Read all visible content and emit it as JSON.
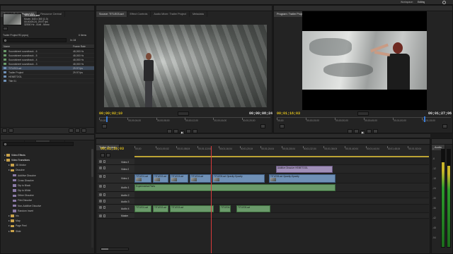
{
  "menu": {
    "items": [
      "File",
      "Edit",
      "Project",
      "Clip",
      "Sequence",
      "Marker",
      "Title",
      "Window",
      "Help"
    ],
    "workspace_label": "Workspace:",
    "workspace_value": "Editing"
  },
  "project": {
    "tabs": [
      "Project: Trailer Project R2",
      "Resource Central"
    ],
    "clip_name": "TITLE03.avi",
    "clip_info": [
      "Movie, 640 x 360 (1.0)",
      "00;00;09;24, 29.97 fps",
      "32000 Hz - 8-bit - Mono",
      "Trailer Project R2.prproj"
    ],
    "item_count": "6 Items",
    "search_placeholder": "In: All",
    "col_name": "Name",
    "col_rate": "Frame Rate",
    "items": [
      {
        "name": "Soundsheet soundtrack - 6",
        "rate": "48,000 Hz"
      },
      {
        "name": "Soundsheet soundtrack - 5",
        "rate": "48,000 Hz"
      },
      {
        "name": "Soundsheet soundtrack - 4",
        "rate": "48,000 Hz"
      },
      {
        "name": "Soundsheet soundtrack - 3",
        "rate": "48,000 Hz"
      },
      {
        "name": "TITLE03.avi",
        "rate": "29.97 fps"
      },
      {
        "name": "Trailer Project",
        "rate": "29.97 fps"
      },
      {
        "name": "HEMETOOL",
        "rate": ""
      },
      {
        "name": "Title 01",
        "rate": ""
      }
    ]
  },
  "source": {
    "tabs": [
      "Source: TITLE03.avi",
      "Effect Controls",
      "Audio Mixer: Trailer Project",
      "Metadata"
    ],
    "timecode_in": "00;00;02;10",
    "timecode_out": "00;00;08;24",
    "ruler": [
      "00;00",
      "00;00;04;00",
      "00;00;08;00",
      "00;00;12;00",
      "00;00;16;00",
      "00;00;20;00"
    ]
  },
  "program": {
    "tabs": [
      "Program: Trailer Project"
    ],
    "timecode_in": "00;01;16;03",
    "timecode_out": "00;01;27;06",
    "ruler": [
      "00;00",
      "00;00;15;00",
      "00;00;30;00",
      "00;00;45;00",
      "00;01;00;00",
      "00;01;15;00"
    ]
  },
  "effects": {
    "tabs": [
      "Media Browser",
      "Info",
      "Effects",
      "History"
    ],
    "items": [
      {
        "label": "Video Effects",
        "level": 0,
        "folder": true
      },
      {
        "label": "Video Transitions",
        "level": 0,
        "folder": true
      },
      {
        "label": "3D Motion",
        "level": 1,
        "folder": true
      },
      {
        "label": "Dissolve",
        "level": 1,
        "folder": true
      },
      {
        "label": "Additive Dissolve",
        "level": 2,
        "folder": false
      },
      {
        "label": "Cross Dissolve",
        "level": 2,
        "folder": false
      },
      {
        "label": "Dip to Black",
        "level": 2,
        "folder": false
      },
      {
        "label": "Dip to White",
        "level": 2,
        "folder": false
      },
      {
        "label": "Dither Dissolve",
        "level": 2,
        "folder": false
      },
      {
        "label": "Film Dissolve",
        "level": 2,
        "folder": false
      },
      {
        "label": "Non-Additive Dissolve",
        "level": 2,
        "folder": false
      },
      {
        "label": "Random Invert",
        "level": 2,
        "folder": false
      },
      {
        "label": "Iris",
        "level": 1,
        "folder": true
      },
      {
        "label": "Map",
        "level": 1,
        "folder": true
      },
      {
        "label": "Page Peel",
        "level": 1,
        "folder": true
      },
      {
        "label": "Slide",
        "level": 1,
        "folder": true
      }
    ]
  },
  "timeline": {
    "tab": "Trailer Project",
    "timecode": "00;01;16;03",
    "ruler": [
      "00;00",
      "00;01;00;02",
      "00;01;08;04",
      "00;01;12;04",
      "00;01;16;04",
      "00;01;20;04",
      "00;01;24;04",
      "00;01;28;04",
      "00;01;32;04",
      "00;01;36;04",
      "00;01;40;04",
      "00;01;44;04",
      "00;01;48;04",
      "00;01;52;04"
    ],
    "tracks": [
      {
        "label": "Video 3",
        "type": "video"
      },
      {
        "label": "Video 2",
        "type": "video"
      },
      {
        "label": "Video 1",
        "type": "video"
      },
      {
        "label": "Audio 1",
        "type": "audio"
      },
      {
        "label": "Audio 2",
        "type": "audio"
      },
      {
        "label": "Audio 3",
        "type": "audio"
      },
      {
        "label": "Audio 4",
        "type": "audio"
      },
      {
        "label": "Master",
        "type": "audio"
      }
    ],
    "clip_v2_label": "Additive Dissolve  HEMETOOL",
    "clip_v1_labels": [
      "TITLE01.avi",
      "TITLE02.avi",
      "TITLE03.avi",
      "TITLE04.avi",
      "TITLE05.avi Opacity:Opacity",
      "TITLE06.avi Opacity:Opacity"
    ],
    "clip_a1_label": "Experimental Parts",
    "clip_a4_labels": [
      "TITLE01.avi",
      "TITLE02.avi",
      "TITLE03.avi",
      "TITLE04.avi",
      "TITLE05.avi"
    ]
  },
  "audio_meter": {
    "tab": "Audio",
    "scale": [
      "0",
      "-6",
      "-12",
      "-18",
      "-24",
      "-30",
      "-36",
      "-42",
      "-48",
      "-54"
    ]
  },
  "colors": {
    "timecode_yellow": "#e3c21b",
    "video_clip": "#6f90b6",
    "audio_clip": "#6a9a6a",
    "transition": "#a08fb8"
  }
}
